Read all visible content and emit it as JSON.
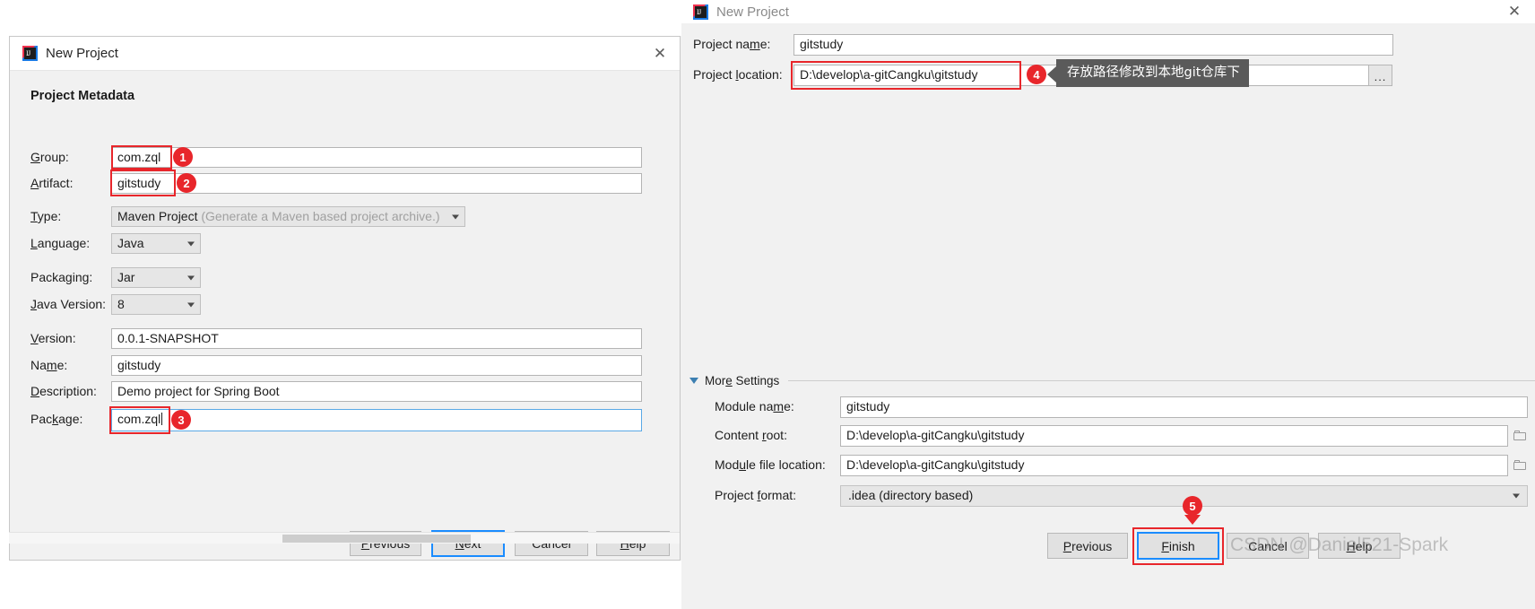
{
  "left_dialog": {
    "title": "New Project",
    "icon": "intellij-idea-icon",
    "close_icon": "close-icon",
    "section_title": "Project Metadata",
    "fields": [
      {
        "label": "Group:",
        "label_mnemonic": "G",
        "value": "com.zql",
        "type": "text",
        "annotated": true,
        "marker": "1"
      },
      {
        "label": "Artifact:",
        "label_mnemonic": "A",
        "value": "gitstudy",
        "type": "text",
        "annotated": true,
        "marker": "2"
      },
      {
        "label": "Type:",
        "label_mnemonic": "T",
        "value": "Maven Project",
        "hint": "(Generate a Maven based project archive.)",
        "type": "combo"
      },
      {
        "label": "Language:",
        "label_mnemonic": "L",
        "value": "Java",
        "type": "combo"
      },
      {
        "label": "Packaging:",
        "label_mnemonic": "g",
        "value": "Jar",
        "type": "combo"
      },
      {
        "label": "Java Version:",
        "label_mnemonic": "J",
        "value": "8",
        "type": "combo"
      },
      {
        "label": "Version:",
        "label_mnemonic": "V",
        "value": "0.0.1-SNAPSHOT",
        "type": "text"
      },
      {
        "label": "Name:",
        "label_mnemonic": "m",
        "value": "gitstudy",
        "type": "text"
      },
      {
        "label": "Description:",
        "label_mnemonic": "D",
        "value": "Demo project for Spring Boot",
        "type": "text"
      },
      {
        "label": "Package:",
        "label_mnemonic": "k",
        "value": "com.zql",
        "type": "text",
        "focused": true,
        "annotated": true,
        "marker": "3"
      }
    ],
    "buttons": [
      {
        "label": "Previous",
        "mnemonic": "P",
        "default": false
      },
      {
        "label": "Next",
        "mnemonic": "N",
        "default": true
      },
      {
        "label": "Cancel",
        "mnemonic": "",
        "default": false
      },
      {
        "label": "Help",
        "mnemonic": "H",
        "default": false
      }
    ]
  },
  "right_dialog": {
    "title": "New Project",
    "icon": "intellij-idea-icon",
    "close_icon": "close-icon",
    "project_name": {
      "label": "Project name:",
      "value": "gitstudy"
    },
    "project_location": {
      "label": "Project location:",
      "value": "D:\\develop\\a-gitCangku\\gitstudy",
      "annotated": true,
      "marker": "4",
      "browse_label": "..."
    },
    "tooltip": "存放路径修改到本地git仓库下",
    "more_settings": {
      "label": "More Settings",
      "expanded": true,
      "fields": [
        {
          "label": "Module name:",
          "value": "gitstudy",
          "type": "text",
          "browse": false
        },
        {
          "label": "Content root:",
          "value": "D:\\develop\\a-gitCangku\\gitstudy",
          "type": "text",
          "browse": true,
          "browse_icon": "folder-icon"
        },
        {
          "label": "Module file location:",
          "value": "D:\\develop\\a-gitCangku\\gitstudy",
          "type": "text",
          "browse": true,
          "browse_icon": "folder-icon"
        },
        {
          "label": "Project format:",
          "value": ".idea (directory based)",
          "type": "combo",
          "browse": false
        }
      ]
    },
    "buttons": [
      {
        "label": "Previous",
        "mnemonic": "P",
        "default": false,
        "annotated": false
      },
      {
        "label": "Finish",
        "mnemonic": "F",
        "default": true,
        "annotated": true,
        "marker": "5"
      },
      {
        "label": "Cancel",
        "mnemonic": "",
        "default": false,
        "annotated": false
      },
      {
        "label": "Help",
        "mnemonic": "H",
        "default": false,
        "annotated": false
      }
    ]
  },
  "watermark": "CSDN @Daniel521-Spark",
  "colors": {
    "annotation_red": "#e8262b",
    "focus_blue": "#1a8cff",
    "tooltip_bg": "#5a5a5a",
    "dialog_bg": "#f1f1f1"
  }
}
